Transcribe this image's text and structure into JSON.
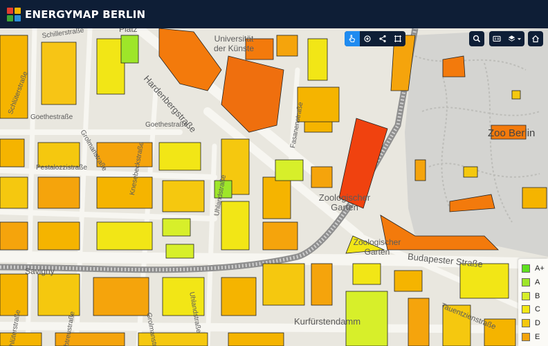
{
  "app": {
    "title": "ENERGYMAP BERLIN"
  },
  "toolbar": {
    "group_one": [
      "pointer-icon",
      "locate-icon",
      "share-icon",
      "crop-icon"
    ],
    "active_tool": "pointer-icon",
    "group_two": [
      "search-icon"
    ],
    "group_three": [
      "layers-legend-icon",
      "layers-icon",
      "chevron-down-icon"
    ],
    "home": "home-icon"
  },
  "map": {
    "street_labels": [
      {
        "text": "Hardenbergstraße"
      },
      {
        "text": "Knesebeckstraße"
      },
      {
        "text": "Goethestraße"
      },
      {
        "text": "Goethestraße"
      },
      {
        "text": "Pestalozzistraße"
      },
      {
        "text": "Grolmanstraße"
      },
      {
        "text": "Grolmanstraße"
      },
      {
        "text": "Uhlandstraße"
      },
      {
        "text": "Uhlandstraße"
      },
      {
        "text": "Fasanenstraße"
      },
      {
        "text": "Schlüterstraße"
      },
      {
        "text": "Schlüterstraße"
      },
      {
        "text": "Schillerstraße"
      },
      {
        "text": "Bleibtreustraße"
      },
      {
        "text": "Budapester Straße"
      },
      {
        "text": "Kurfürstendamm"
      },
      {
        "text": "Tauentzienstraße"
      },
      {
        "text": "Savigny"
      }
    ],
    "place_labels": [
      {
        "text": "Universität der Künste"
      },
      {
        "text": "Zoo Berlin"
      },
      {
        "text": "Zoologischer Garten"
      },
      {
        "text": "Zoologischer Garten"
      },
      {
        "text": "Platz"
      }
    ]
  },
  "legend": {
    "items": [
      {
        "label": "A+",
        "color": "#5fe01f"
      },
      {
        "label": "A",
        "color": "#9ee629"
      },
      {
        "label": "B",
        "color": "#d7ef2a"
      },
      {
        "label": "C",
        "color": "#f2e616"
      },
      {
        "label": "D",
        "color": "#f5c80f"
      },
      {
        "label": "E",
        "color": "#f5a40c"
      }
    ]
  }
}
